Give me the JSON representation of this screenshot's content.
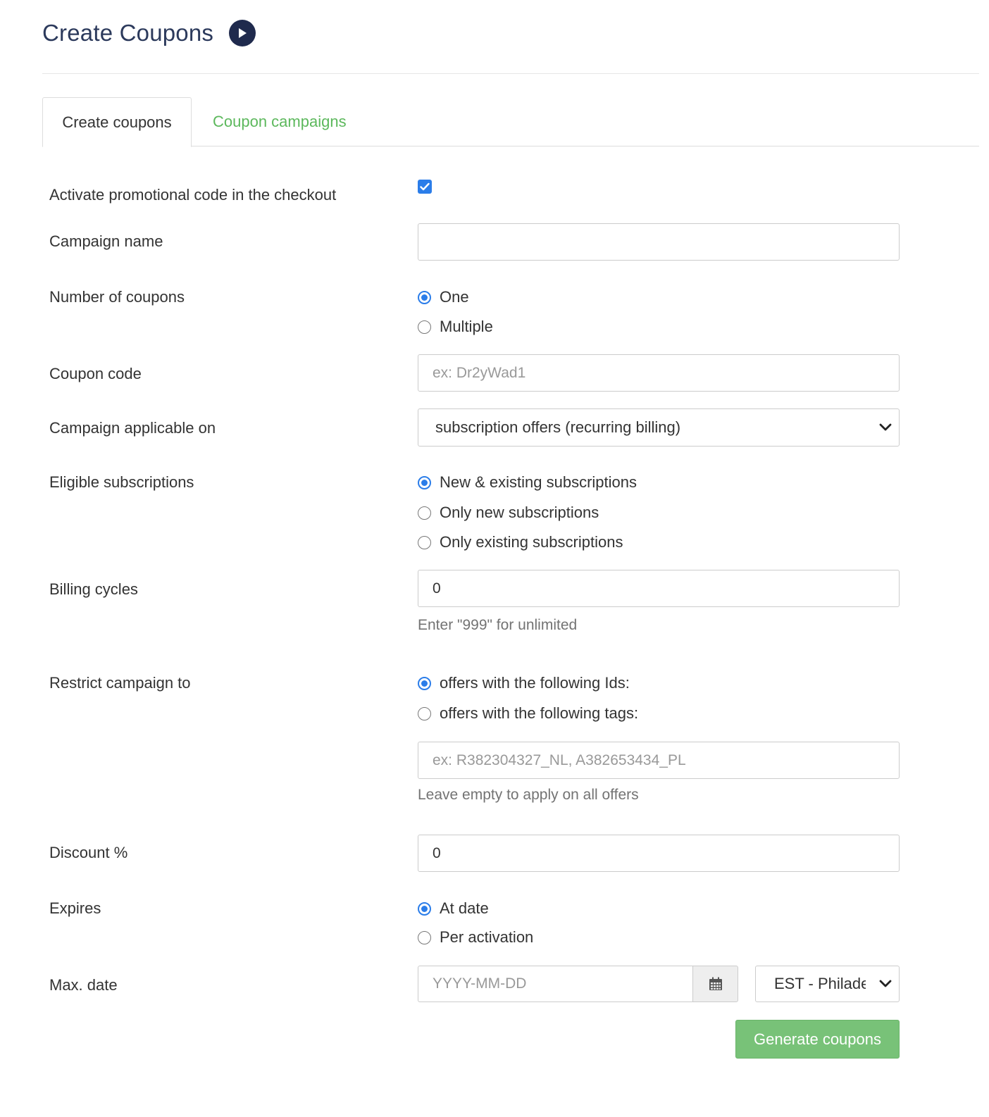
{
  "header": {
    "title": "Create Coupons",
    "play_icon": "play-circle-icon"
  },
  "tabs": [
    {
      "label": "Create coupons",
      "active": true
    },
    {
      "label": "Coupon campaigns",
      "active": false
    }
  ],
  "colors": {
    "accent": "#2b7de9",
    "link_green": "#5cb85c",
    "button_green": "#78c278",
    "title_navy": "#2c3a5c"
  },
  "form": {
    "activate": {
      "label": "Activate promotional code in the checkout",
      "checked": true
    },
    "campaign_name": {
      "label": "Campaign name",
      "value": "",
      "placeholder": ""
    },
    "number_of_coupons": {
      "label": "Number of coupons",
      "options": [
        "One",
        "Multiple"
      ],
      "selected": "One"
    },
    "coupon_code": {
      "label": "Coupon code",
      "value": "",
      "placeholder": "ex: Dr2yWad1"
    },
    "applicable_on": {
      "label": "Campaign applicable on",
      "selected": "subscription offers (recurring billing)"
    },
    "eligible_subscriptions": {
      "label": "Eligible subscriptions",
      "options": [
        "New & existing subscriptions",
        "Only new subscriptions",
        "Only existing subscriptions"
      ],
      "selected": "New & existing subscriptions"
    },
    "billing_cycles": {
      "label": "Billing cycles",
      "value": "0",
      "help": "Enter \"999\" for unlimited"
    },
    "restrict": {
      "label": "Restrict campaign to",
      "options": [
        "offers with the following Ids:",
        "offers with the following tags:"
      ],
      "selected": "offers with the following Ids:",
      "value": "",
      "placeholder": "ex: R382304327_NL, A382653434_PL",
      "help": "Leave empty to apply on all offers"
    },
    "discount": {
      "label": "Discount %",
      "value": "0"
    },
    "expires": {
      "label": "Expires",
      "options": [
        "At date",
        "Per activation"
      ],
      "selected": "At date"
    },
    "max_date": {
      "label": "Max. date",
      "value": "",
      "placeholder": "YYYY-MM-DD",
      "calendar_icon": "calendar-icon",
      "timezone": "EST - Philadelphia"
    },
    "submit_label": "Generate coupons"
  }
}
